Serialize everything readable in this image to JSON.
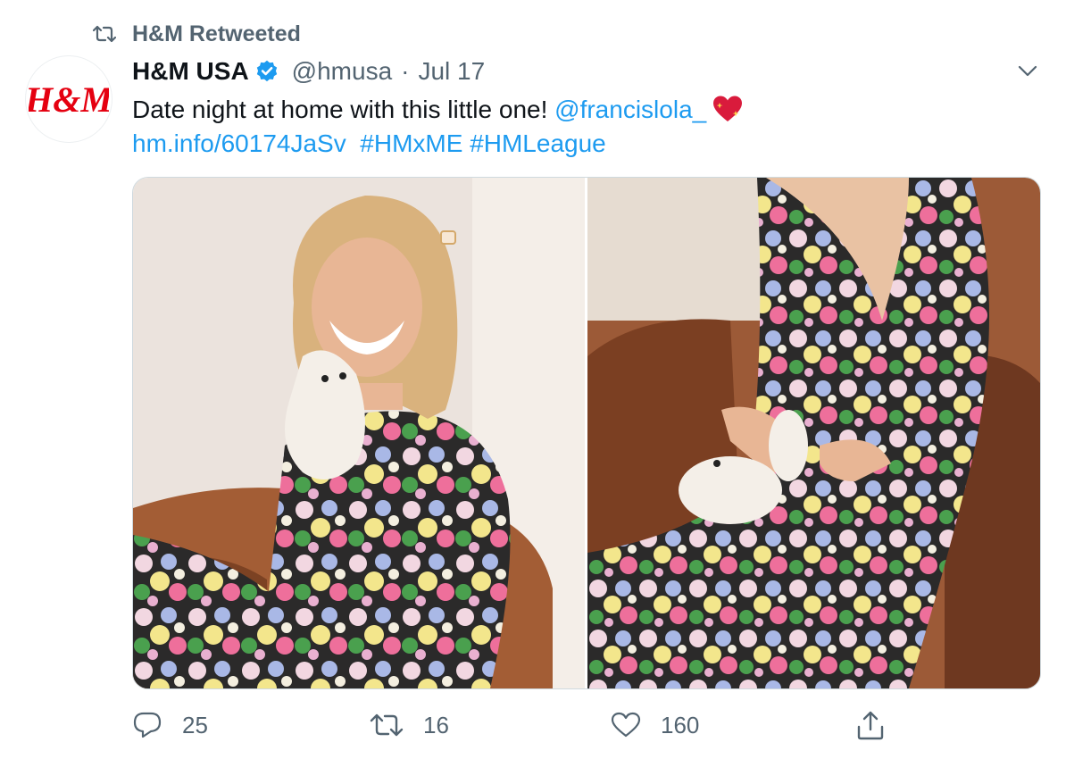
{
  "retweet_header": {
    "label": "H&M Retweeted"
  },
  "author": {
    "avatar_text": "H&M",
    "name": "H&M USA",
    "handle": "@hmusa",
    "separator": "·",
    "date": "Jul 17"
  },
  "tweet": {
    "text": "Date night at home with this little one! ",
    "mention": "@francislola_",
    "emoji": "sparkling-heart",
    "link": "hm.info/60174JaSv",
    "hashtags": [
      "#HMxME",
      "#HMLeague"
    ]
  },
  "media": {
    "photos": [
      "woman-with-puppy-photo",
      "dress-and-puppy-photo"
    ]
  },
  "actions": {
    "replies": "25",
    "retweets": "16",
    "likes": "160"
  },
  "colors": {
    "brand_red": "#e50010",
    "link_blue": "#1d9bf0",
    "verified_blue": "#1d9bf0",
    "secondary_text": "#536471"
  }
}
